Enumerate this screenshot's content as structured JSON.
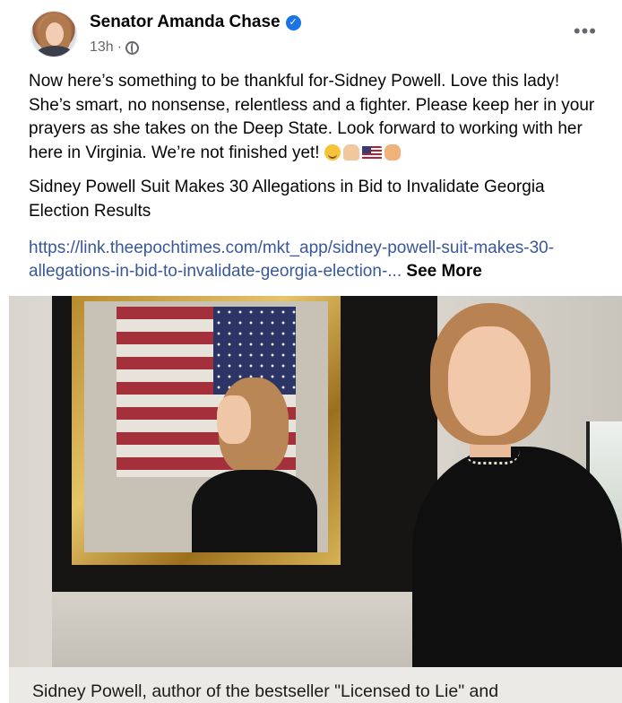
{
  "post": {
    "author": "Senator Amanda Chase",
    "verified_icon": "verified-badge-icon",
    "timestamp": "13h",
    "separator": " · ",
    "audience_icon": "globe-icon",
    "more_label": "•••",
    "text_line": "Now here’s something to be thankful for-Sidney Powell.  Love this lady!  She’s smart, no nonsense, relentless and a fighter.  Please keep her in your prayers as she takes on the Deep State.  Look forward to working with her here in Virginia.  We’re not finished yet!",
    "emojis": [
      "smiling-face-emoji",
      "folded-hands-emoji",
      "us-flag-emoji",
      "fist-emoji"
    ],
    "headline": "Sidney Powell Suit Makes 30 Allegations in Bid to Invalidate Georgia Election Results",
    "link": "https://link.theepochtimes.com/mkt_app/sidney-powell-suit-makes-30-allegations-in-bid-to-invalidate-georgia-election-...",
    "see_more": "See More"
  },
  "photo": {
    "caption": "Sidney Powell, author of the bestseller \"Licensed to Lie\" and"
  }
}
